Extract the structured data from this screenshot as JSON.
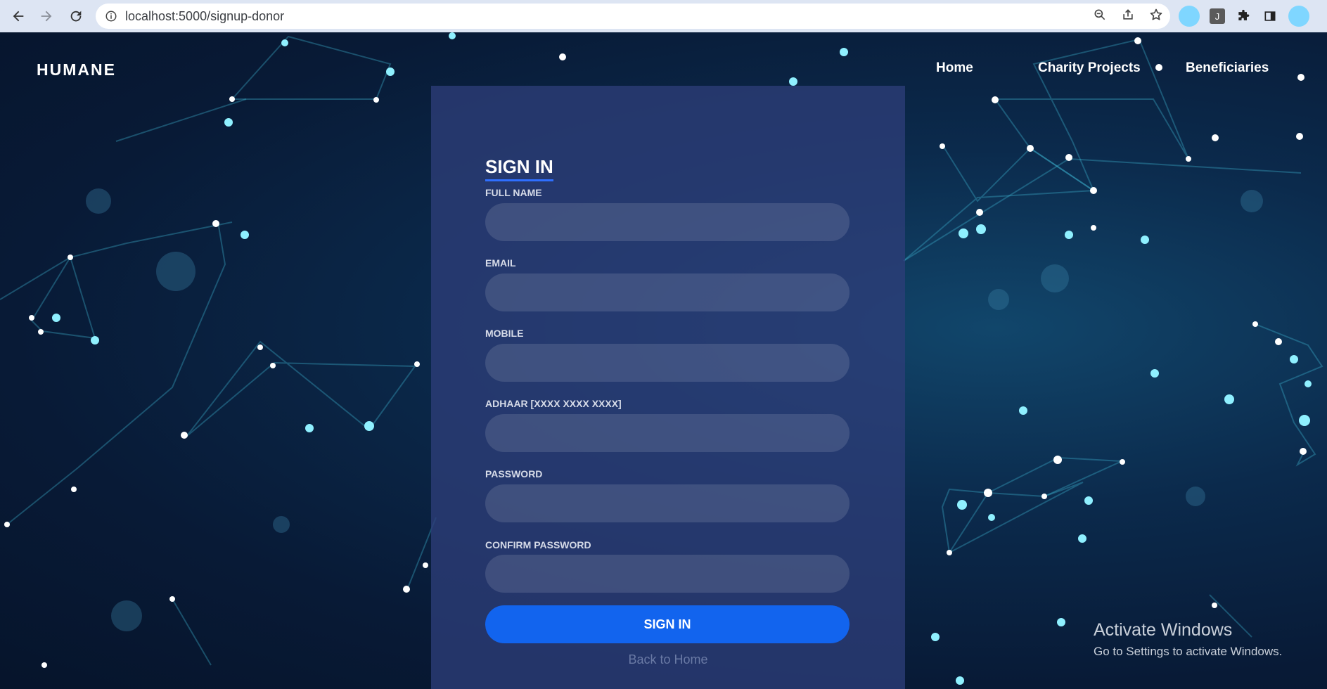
{
  "browser": {
    "url": "localhost:5000/signup-donor",
    "icons": [
      "back-arrow-icon",
      "forward-arrow-icon",
      "reload-icon",
      "info-icon",
      "zoom-icon",
      "share-icon",
      "star-icon",
      "puzzle-icon",
      "sidepanel-icon"
    ]
  },
  "header": {
    "brand": "HUMANE",
    "nav": {
      "home": "Home",
      "projects": "Charity Projects",
      "beneficiaries": "Beneficiaries"
    }
  },
  "form": {
    "title": "SIGN IN",
    "fields": {
      "full_name": "FULL NAME",
      "email": "EMAIL",
      "mobile": "MOBILE",
      "adhaar": "ADHAAR [XXXX XXXX XXXX]",
      "password": "PASSWORD",
      "confirm_password": "CONFIRM PASSWORD"
    },
    "submit_label": "SIGN IN",
    "back_link": "Back to Home"
  },
  "watermark": {
    "title": "Activate Windows",
    "subtitle": "Go to Settings to activate Windows."
  },
  "colors": {
    "accent": "#1264ee",
    "card": "#2d3e78",
    "background": "#081a36"
  }
}
